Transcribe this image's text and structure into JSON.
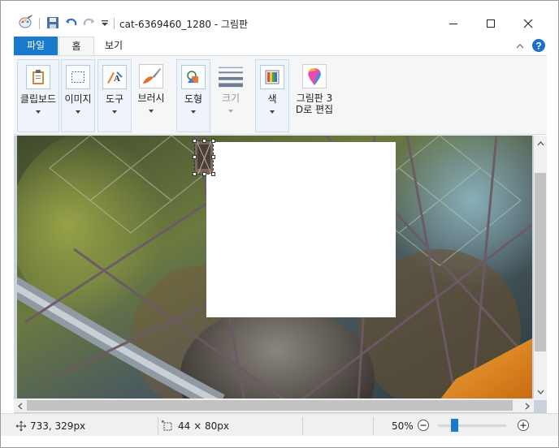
{
  "window": {
    "title": "cat-6369460_1280 - 그림판",
    "minimize_icon": "minimize-icon",
    "maximize_icon": "maximize-icon",
    "close_icon": "close-icon"
  },
  "quick_access": {
    "app_icon": "paint-app-icon",
    "save_icon": "save-icon",
    "undo_icon": "undo-icon",
    "redo_icon": "redo-icon",
    "customize_icon": "dropdown-arrow-icon"
  },
  "tabs": [
    {
      "label": "파일"
    },
    {
      "label": "홈"
    },
    {
      "label": "보기"
    }
  ],
  "ribbon": {
    "groups": [
      {
        "label": "클립보드",
        "icon": "clipboard-icon"
      },
      {
        "label": "이미지",
        "icon": "select-icon"
      },
      {
        "label": "도구",
        "icon": "tools-icon"
      },
      {
        "label": "브러시",
        "icon": "brush-icon"
      },
      {
        "label": "도형",
        "icon": "shapes-icon"
      },
      {
        "label": "크기",
        "icon": "line-size-icon",
        "disabled": true
      },
      {
        "label": "색",
        "icon": "colors-icon"
      },
      {
        "label": "그림판 3\nD로 편집",
        "icon": "paint3d-icon"
      }
    ]
  },
  "statusbar": {
    "cursor_position": "733, 329px",
    "selection_size": "44 × 80px",
    "zoom_label": "50%",
    "zoom_level": 50
  },
  "colors": {
    "accent": "#1979ca",
    "ribbon_bg": "#f5f6f7",
    "canvas_bg": "#c8d1dc"
  }
}
